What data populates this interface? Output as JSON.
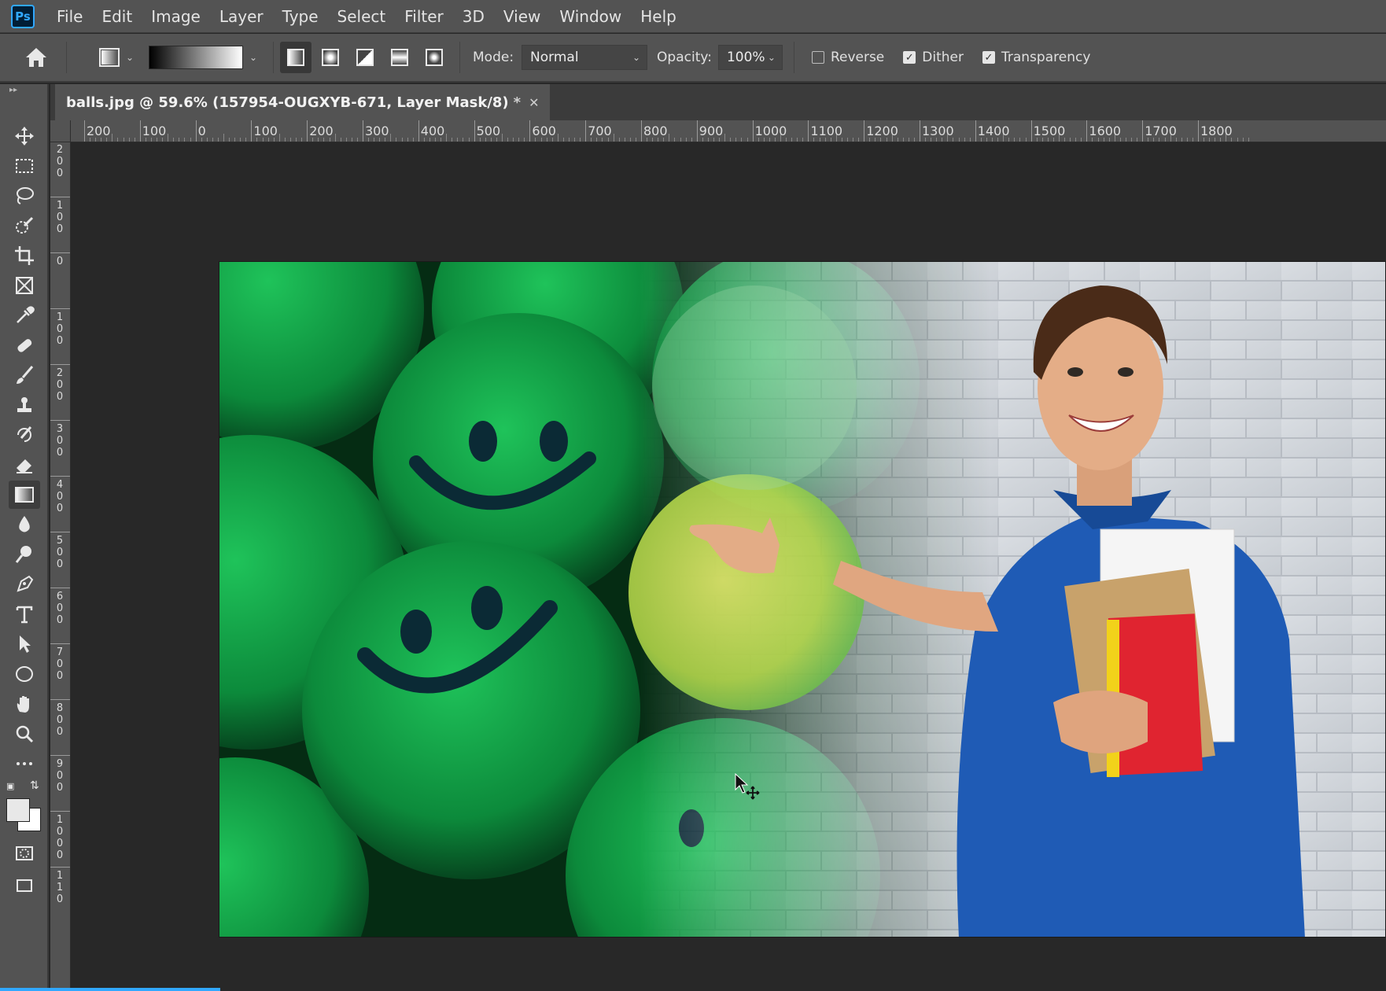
{
  "app": {
    "logo_text": "Ps",
    "accent": "#31a8ff"
  },
  "menu": [
    "File",
    "Edit",
    "Image",
    "Layer",
    "Type",
    "Select",
    "Filter",
    "3D",
    "View",
    "Window",
    "Help"
  ],
  "options": {
    "mode_label": "Mode:",
    "mode_value": "Normal",
    "opacity_label": "Opacity:",
    "opacity_value": "100%",
    "reverse_label": "Reverse",
    "reverse_checked": false,
    "dither_label": "Dither",
    "dither_checked": true,
    "transparency_label": "Transparency",
    "transparency_checked": true,
    "gradient_types": [
      "linear",
      "radial",
      "angle",
      "reflected",
      "diamond"
    ],
    "active_gradient_type": "linear"
  },
  "document": {
    "tab_title": "balls.jpg @ 59.6% (157954-OUGXYB-671, Layer Mask/8)",
    "modified_marker": "*",
    "close_glyph": "✕"
  },
  "ruler_top": [
    "200",
    "100",
    "0",
    "100",
    "200",
    "300",
    "400",
    "500",
    "600",
    "700",
    "800",
    "900",
    "1000",
    "1100",
    "1200",
    "1300",
    "1400",
    "1500",
    "1600",
    "1700",
    "1800"
  ],
  "ruler_left": [
    "2 0 0",
    "1 0 0",
    "0",
    "1 0 0",
    "2 0 0",
    "3 0 0",
    "4 0 0",
    "5 0 0",
    "6 0 0",
    "7 0 0",
    "8 0 0",
    "9 0 0",
    "1 0 0 0",
    "1 1 0"
  ],
  "tools": [
    "move-tool",
    "marquee-tool",
    "lasso-tool",
    "quick-selection-tool",
    "crop-tool",
    "frame-tool",
    "eyedropper-tool",
    "healing-brush-tool",
    "brush-tool",
    "clone-stamp-tool",
    "history-brush-tool",
    "eraser-tool",
    "gradient-tool",
    "blur-tool",
    "dodge-tool",
    "pen-tool",
    "type-tool",
    "path-selection-tool",
    "ellipse-tool",
    "hand-tool",
    "zoom-tool",
    "edit-toolbar"
  ],
  "active_tool": "gradient-tool",
  "colors": {
    "foreground": "#e8e8e8",
    "background": "#ffffff"
  }
}
